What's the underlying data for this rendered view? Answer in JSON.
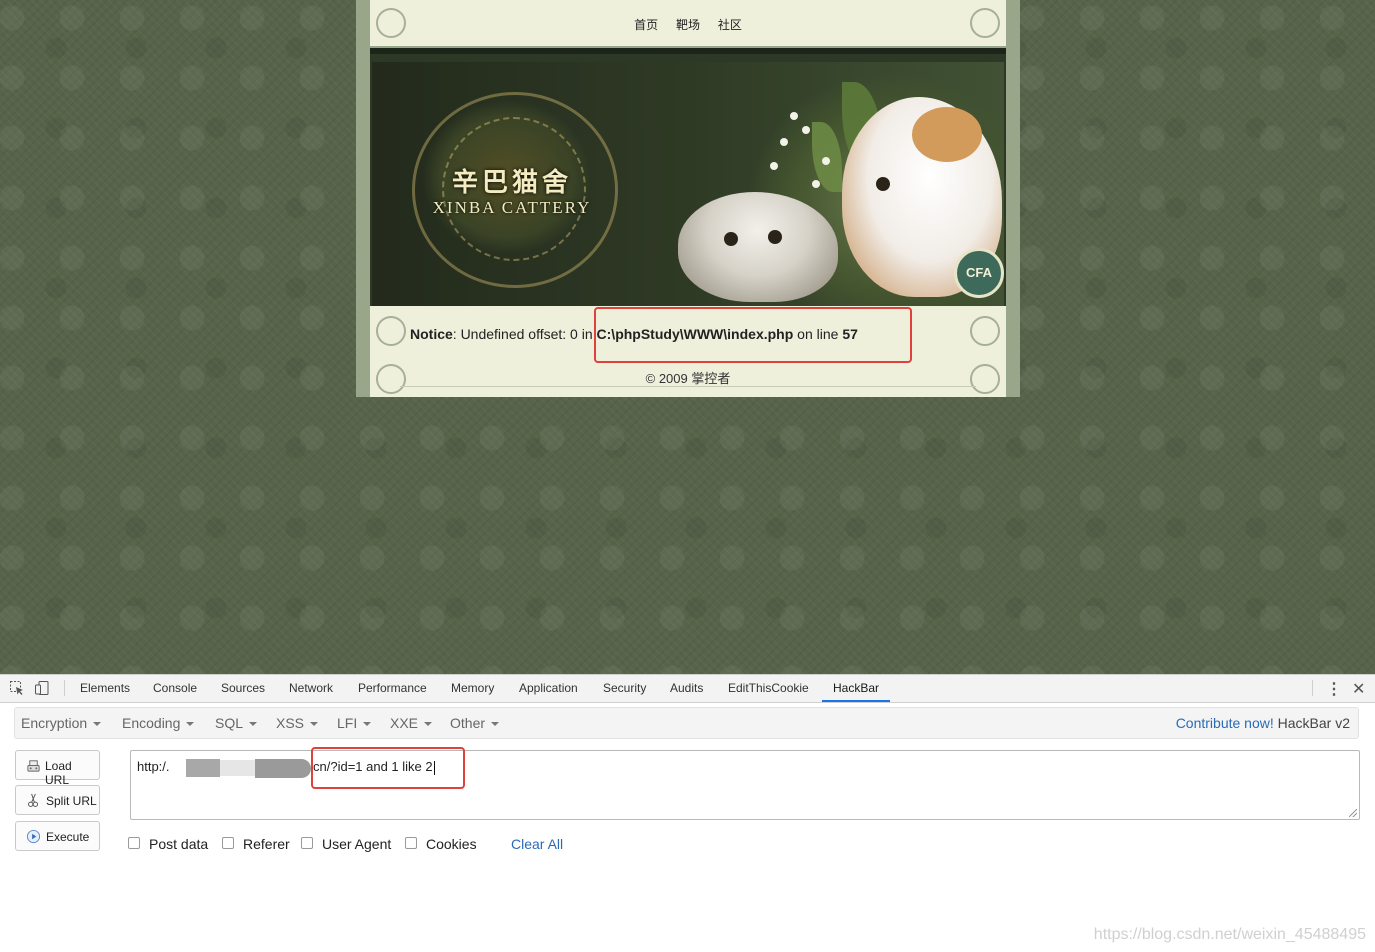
{
  "site": {
    "nav": [
      "首页",
      "靶场",
      "社区"
    ],
    "banner_title_cn": "辛巴猫舍",
    "banner_title_en": "XINBA CATTERY",
    "badge_text": "CFA",
    "notice": {
      "label": "Notice",
      "message": ": Undefined offset: 0 in ",
      "path": "C:\\phpStudy\\WWW\\index.php",
      "on_line": " on line ",
      "line": "57"
    },
    "copyright": "© 2009 掌控者"
  },
  "devtools": {
    "tabs": [
      "Elements",
      "Console",
      "Sources",
      "Network",
      "Performance",
      "Memory",
      "Application",
      "Security",
      "Audits",
      "EditThisCookie",
      "HackBar"
    ],
    "active_tab": "HackBar",
    "icons": [
      "inspect-icon",
      "device-toolbar-icon",
      "more-vert-icon",
      "close-icon"
    ]
  },
  "hackbar": {
    "menus": [
      "Encryption",
      "Encoding",
      "SQL",
      "XSS",
      "LFI",
      "XXE",
      "Other"
    ],
    "contribute_link": "Contribute now!",
    "version": "HackBar v2",
    "buttons": {
      "load_url": "Load URL",
      "split_url": "Split URL",
      "execute": "Execute"
    },
    "url_prefix": "http:/.",
    "url_suffix": "cn/?id=1 and 1 like 2",
    "options": [
      "Post data",
      "Referer",
      "User Agent",
      "Cookies"
    ],
    "clear_all": "Clear All",
    "highlight_color": "#e0413a",
    "link_color": "#2a6bb8"
  },
  "watermark": "https://blog.csdn.net/weixin_45488495"
}
